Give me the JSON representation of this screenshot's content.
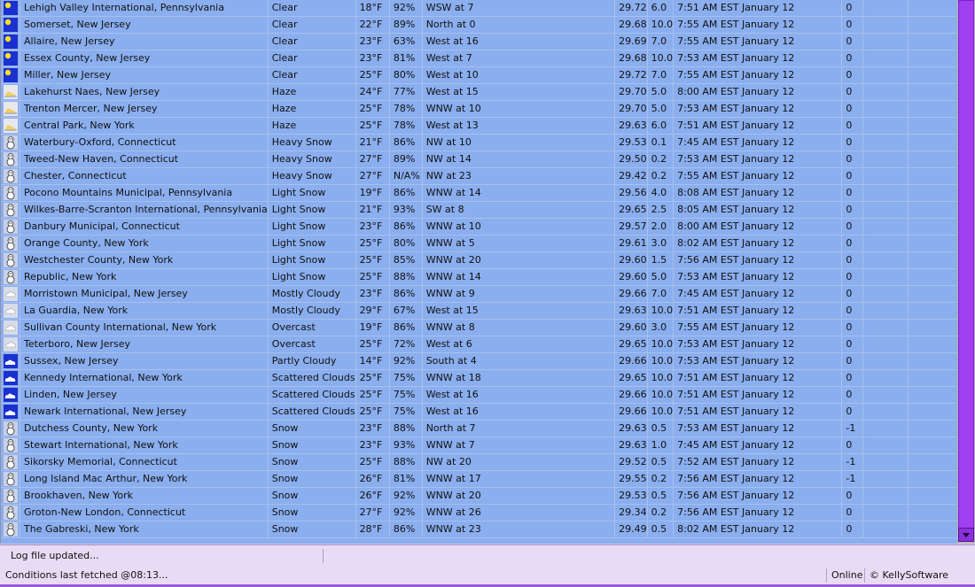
{
  "rows": [
    {
      "icon": "sunny-icon",
      "location": "Lehigh Valley International, Pennsylvania",
      "condition": "Clear",
      "temp": "18°F",
      "humidity": "92%",
      "wind": "WSW at 7",
      "pressure": "29.72",
      "visibility": "6.0",
      "updated": "7:51 AM EST January 12",
      "change": "0"
    },
    {
      "icon": "sunny-icon",
      "location": "Somerset, New Jersey",
      "condition": "Clear",
      "temp": "22°F",
      "humidity": "89%",
      "wind": "North at 0",
      "pressure": "29.68",
      "visibility": "10.0",
      "updated": "7:55 AM EST January 12",
      "change": "0"
    },
    {
      "icon": "sunny-icon",
      "location": "Allaire, New Jersey",
      "condition": "Clear",
      "temp": "23°F",
      "humidity": "63%",
      "wind": "West at 16",
      "pressure": "29.69",
      "visibility": "7.0",
      "updated": "7:55 AM EST January 12",
      "change": "0"
    },
    {
      "icon": "sunny-icon",
      "location": "Essex County, New Jersey",
      "condition": "Clear",
      "temp": "23°F",
      "humidity": "81%",
      "wind": "West at 7",
      "pressure": "29.68",
      "visibility": "10.0",
      "updated": "7:53 AM EST January 12",
      "change": "0"
    },
    {
      "icon": "sunny-icon",
      "location": "Miller, New Jersey",
      "condition": "Clear",
      "temp": "25°F",
      "humidity": "80%",
      "wind": "West at 10",
      "pressure": "29.72",
      "visibility": "7.0",
      "updated": "7:55 AM EST January 12",
      "change": "0"
    },
    {
      "icon": "haze-icon",
      "location": "Lakehurst Naes, New Jersey",
      "condition": "Haze",
      "temp": "24°F",
      "humidity": "77%",
      "wind": "West at 15",
      "pressure": "29.70",
      "visibility": "5.0",
      "updated": "8:00 AM EST January 12",
      "change": "0"
    },
    {
      "icon": "haze-icon",
      "location": "Trenton Mercer, New Jersey",
      "condition": "Haze",
      "temp": "25°F",
      "humidity": "78%",
      "wind": "WNW at 10",
      "pressure": "29.70",
      "visibility": "5.0",
      "updated": "7:53 AM EST January 12",
      "change": "0"
    },
    {
      "icon": "haze-icon",
      "location": "Central Park, New York",
      "condition": "Haze",
      "temp": "25°F",
      "humidity": "78%",
      "wind": "West at 13",
      "pressure": "29.63",
      "visibility": "6.0",
      "updated": "7:51 AM EST January 12",
      "change": "0"
    },
    {
      "icon": "snowman-icon",
      "location": "Waterbury-Oxford, Connecticut",
      "condition": "Heavy Snow",
      "temp": "21°F",
      "humidity": "86%",
      "wind": "NW at 10",
      "pressure": "29.53",
      "visibility": "0.1",
      "updated": "7:45 AM EST January 12",
      "change": "0"
    },
    {
      "icon": "snowman-icon",
      "location": "Tweed-New Haven, Connecticut",
      "condition": "Heavy Snow",
      "temp": "27°F",
      "humidity": "89%",
      "wind": "NW at 14",
      "pressure": "29.50",
      "visibility": "0.2",
      "updated": "7:53 AM EST January 12",
      "change": "0"
    },
    {
      "icon": "snowman-icon",
      "location": "Chester, Connecticut",
      "condition": "Heavy Snow",
      "temp": "27°F",
      "humidity": "N/A%",
      "wind": "NW at 23",
      "pressure": "29.42",
      "visibility": "0.2",
      "updated": "7:55 AM EST January 12",
      "change": "0"
    },
    {
      "icon": "snowman-icon",
      "location": "Pocono Mountains Municipal, Pennsylvania",
      "condition": "Light Snow",
      "temp": "19°F",
      "humidity": "86%",
      "wind": "WNW at 14",
      "pressure": "29.56",
      "visibility": "4.0",
      "updated": "8:08 AM EST January 12",
      "change": "0"
    },
    {
      "icon": "snowman-icon",
      "location": "Wilkes-Barre-Scranton International, Pennsylvania",
      "condition": "Light Snow",
      "temp": "21°F",
      "humidity": "93%",
      "wind": "SW at 8",
      "pressure": "29.65",
      "visibility": "2.5",
      "updated": "8:05 AM EST January 12",
      "change": "0"
    },
    {
      "icon": "snowman-icon",
      "location": "Danbury Municipal, Connecticut",
      "condition": "Light Snow",
      "temp": "23°F",
      "humidity": "86%",
      "wind": "WNW at 10",
      "pressure": "29.57",
      "visibility": "2.0",
      "updated": "8:00 AM EST January 12",
      "change": "0"
    },
    {
      "icon": "snowman-icon",
      "location": "Orange County, New York",
      "condition": "Light Snow",
      "temp": "25°F",
      "humidity": "80%",
      "wind": "WNW at 5",
      "pressure": "29.61",
      "visibility": "3.0",
      "updated": "8:02 AM EST January 12",
      "change": "0"
    },
    {
      "icon": "snowman-icon",
      "location": "Westchester County, New York",
      "condition": "Light Snow",
      "temp": "25°F",
      "humidity": "85%",
      "wind": "WNW at 20",
      "pressure": "29.60",
      "visibility": "1.5",
      "updated": "7:56 AM EST January 12",
      "change": "0"
    },
    {
      "icon": "snowman-icon",
      "location": "Republic, New York",
      "condition": "Light Snow",
      "temp": "25°F",
      "humidity": "88%",
      "wind": "WNW at 14",
      "pressure": "29.60",
      "visibility": "5.0",
      "updated": "7:53 AM EST January 12",
      "change": "0"
    },
    {
      "icon": "cloudy-icon",
      "location": "Morristown Municipal, New Jersey",
      "condition": "Mostly Cloudy",
      "temp": "23°F",
      "humidity": "86%",
      "wind": "WNW at 9",
      "pressure": "29.66",
      "visibility": "7.0",
      "updated": "7:45 AM EST January 12",
      "change": "0"
    },
    {
      "icon": "cloudy-icon",
      "location": "La Guardia, New York",
      "condition": "Mostly Cloudy",
      "temp": "29°F",
      "humidity": "67%",
      "wind": "West at 15",
      "pressure": "29.63",
      "visibility": "10.0",
      "updated": "7:51 AM EST January 12",
      "change": "0"
    },
    {
      "icon": "cloudy-icon",
      "location": "Sullivan County International, New York",
      "condition": "Overcast",
      "temp": "19°F",
      "humidity": "86%",
      "wind": "WNW at 8",
      "pressure": "29.60",
      "visibility": "3.0",
      "updated": "7:55 AM EST January 12",
      "change": "0"
    },
    {
      "icon": "cloudy-icon",
      "location": "Teterboro, New Jersey",
      "condition": "Overcast",
      "temp": "25°F",
      "humidity": "72%",
      "wind": "West at 6",
      "pressure": "29.65",
      "visibility": "10.0",
      "updated": "7:53 AM EST January 12",
      "change": "0"
    },
    {
      "icon": "partly-cloudy-icon",
      "location": "Sussex, New Jersey",
      "condition": "Partly Cloudy",
      "temp": "14°F",
      "humidity": "92%",
      "wind": "South at 4",
      "pressure": "29.66",
      "visibility": "10.0",
      "updated": "7:53 AM EST January 12",
      "change": "0"
    },
    {
      "icon": "partly-cloudy-icon",
      "location": "Kennedy International, New York",
      "condition": "Scattered Clouds",
      "temp": "25°F",
      "humidity": "75%",
      "wind": "WNW at 18",
      "pressure": "29.65",
      "visibility": "10.0",
      "updated": "7:51 AM EST January 12",
      "change": "0"
    },
    {
      "icon": "partly-cloudy-icon",
      "location": "Linden, New Jersey",
      "condition": "Scattered Clouds",
      "temp": "25°F",
      "humidity": "75%",
      "wind": "West at 16",
      "pressure": "29.66",
      "visibility": "10.0",
      "updated": "7:51 AM EST January 12",
      "change": "0"
    },
    {
      "icon": "partly-cloudy-icon",
      "location": "Newark International, New Jersey",
      "condition": "Scattered Clouds",
      "temp": "25°F",
      "humidity": "75%",
      "wind": "West at 16",
      "pressure": "29.66",
      "visibility": "10.0",
      "updated": "7:51 AM EST January 12",
      "change": "0"
    },
    {
      "icon": "snowman-icon",
      "location": "Dutchess County, New York",
      "condition": "Snow",
      "temp": "23°F",
      "humidity": "88%",
      "wind": "North at 7",
      "pressure": "29.63",
      "visibility": "0.5",
      "updated": "7:53 AM EST January 12",
      "change": "-1"
    },
    {
      "icon": "snowman-icon",
      "location": "Stewart International, New York",
      "condition": "Snow",
      "temp": "23°F",
      "humidity": "93%",
      "wind": "WNW at 7",
      "pressure": "29.63",
      "visibility": "1.0",
      "updated": "7:45 AM EST January 12",
      "change": "0"
    },
    {
      "icon": "snowman-icon",
      "location": "Sikorsky Memorial, Connecticut",
      "condition": "Snow",
      "temp": "25°F",
      "humidity": "88%",
      "wind": "NW at 20",
      "pressure": "29.52",
      "visibility": "0.5",
      "updated": "7:52 AM EST January 12",
      "change": "-1"
    },
    {
      "icon": "snowman-icon",
      "location": "Long Island Mac Arthur, New York",
      "condition": "Snow",
      "temp": "26°F",
      "humidity": "81%",
      "wind": "WNW at 17",
      "pressure": "29.55",
      "visibility": "0.2",
      "updated": "7:56 AM EST January 12",
      "change": "-1"
    },
    {
      "icon": "snowman-icon",
      "location": "Brookhaven, New York",
      "condition": "Snow",
      "temp": "26°F",
      "humidity": "92%",
      "wind": "WNW at 20",
      "pressure": "29.53",
      "visibility": "0.5",
      "updated": "7:56 AM EST January 12",
      "change": "0"
    },
    {
      "icon": "snowman-icon",
      "location": "Groton-New London, Connecticut",
      "condition": "Snow",
      "temp": "27°F",
      "humidity": "92%",
      "wind": "WNW at 26",
      "pressure": "29.34",
      "visibility": "0.2",
      "updated": "7:56 AM EST January 12",
      "change": "0"
    },
    {
      "icon": "snowman-icon",
      "location": "The Gabreski, New York",
      "condition": "Snow",
      "temp": "28°F",
      "humidity": "86%",
      "wind": "WNW at 23",
      "pressure": "29.49",
      "visibility": "0.5",
      "updated": "8:02 AM EST January 12",
      "change": "0"
    }
  ],
  "log": {
    "message": "Log file updated..."
  },
  "status": {
    "fetched": "Conditions last fetched @08:13...",
    "online": "Online",
    "copyright": "© KellySoftware"
  },
  "colors": {
    "grid_bg": "#8aaeee",
    "scrollbar_thumb": "#a040f0",
    "statusbar_bg": "#e8dcf4"
  }
}
